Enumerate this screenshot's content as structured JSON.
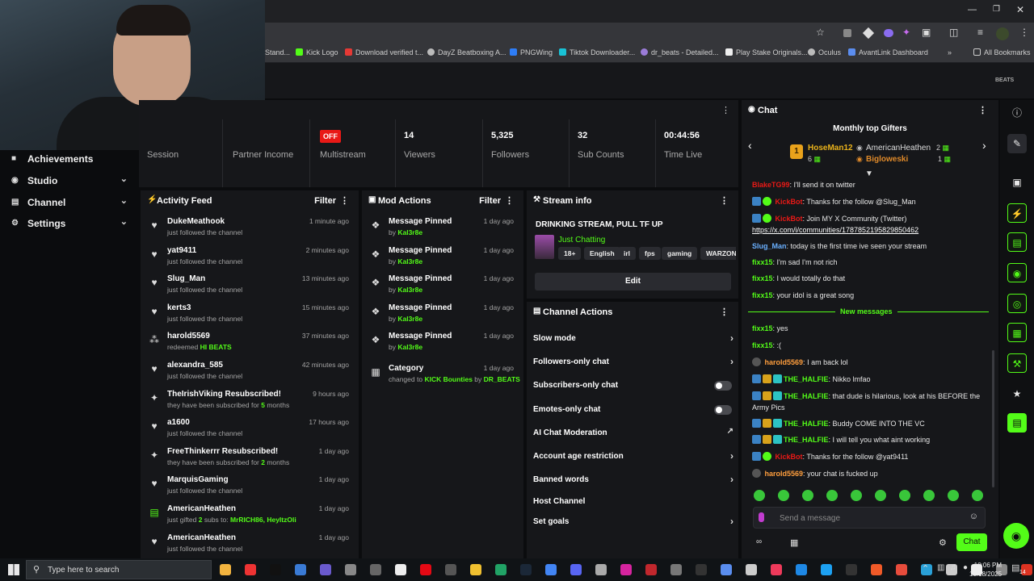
{
  "browser": {
    "bookmarks": [
      "Stand...",
      "Kick Logo",
      "Download verified t...",
      "DayZ Beatboxing A...",
      "PNGWing",
      "Tiktok Downloader...",
      "dr_beats - Detailed...",
      "Play Stake Originals...",
      "Oculus",
      "AvantLink Dashboard"
    ],
    "all_bookmarks": "All Bookmarks"
  },
  "brand_label": "BEATS",
  "nav": [
    {
      "label": "Achievements",
      "icon": "trophy-icon"
    },
    {
      "label": "Studio",
      "icon": "studio-icon"
    },
    {
      "label": "Channel",
      "icon": "channel-icon"
    },
    {
      "label": "Settings",
      "icon": "gear-icon"
    }
  ],
  "stats": {
    "session_label": "Session",
    "partner_label": "Partner Income",
    "multistream_badge": "OFF",
    "multistream_label": "Multistream",
    "viewers": "14",
    "viewers_label": "Viewers",
    "followers": "5,325",
    "followers_label": "Followers",
    "subs": "32",
    "subs_label": "Sub Counts",
    "time": "00:44:56",
    "time_label": "Time Live"
  },
  "activity": {
    "title": "Activity Feed",
    "filter": "Filter",
    "items": [
      {
        "name": "DukeMeathook",
        "sub": "just followed the channel",
        "time": "1 minute ago",
        "icon": "♥"
      },
      {
        "name": "yat9411",
        "sub": "just followed the channel",
        "time": "2 minutes ago",
        "icon": "♥"
      },
      {
        "name": "Slug_Man",
        "sub": "just followed the channel",
        "time": "13 minutes ago",
        "icon": "♥"
      },
      {
        "name": "kerts3",
        "sub": "just followed the channel",
        "time": "15 minutes ago",
        "icon": "♥"
      },
      {
        "name": "harold5569",
        "sub": "redeemed ",
        "hl": "HI BEATS",
        "time": "37 minutes ago",
        "icon": "⁂"
      },
      {
        "name": "alexandra_585",
        "sub": "just followed the channel",
        "time": "42 minutes ago",
        "icon": "♥"
      },
      {
        "name": "TheIrishViking Resubscribed!",
        "sub": "they have been subscribed for ",
        "hl": "5",
        "sub2": " months",
        "time": "9 hours ago",
        "icon": "✦"
      },
      {
        "name": "a1600",
        "sub": "just followed the channel",
        "time": "17 hours ago",
        "icon": "♥"
      },
      {
        "name": "FreeThinkerrr Resubscribed!",
        "sub": "they have been subscribed for ",
        "hl": "2",
        "sub2": " months",
        "time": "1 day ago",
        "icon": "✦"
      },
      {
        "name": "MarquisGaming",
        "sub": "just followed the channel",
        "time": "1 day ago",
        "icon": "♥"
      },
      {
        "name": "AmericanHeathen",
        "sub": "just gifted ",
        "hl": "2",
        "sub2": " subs to: ",
        "hl2": "MrRICH86, HeyItzOli",
        "time": "1 day ago",
        "icon": "▤"
      },
      {
        "name": "AmericanHeathen",
        "sub": "just followed the channel",
        "time": "1 day ago",
        "icon": "♥"
      }
    ]
  },
  "mod": {
    "title": "Mod Actions",
    "filter": "Filter",
    "items": [
      {
        "name": "Message Pinned",
        "by": "by ",
        "who": "Kal3r8e",
        "time": "1 day ago"
      },
      {
        "name": "Message Pinned",
        "by": "by ",
        "who": "Kal3r8e",
        "time": "1 day ago"
      },
      {
        "name": "Message Pinned",
        "by": "by ",
        "who": "Kal3r8e",
        "time": "1 day ago"
      },
      {
        "name": "Message Pinned",
        "by": "by ",
        "who": "Kal3r8e",
        "time": "1 day ago"
      },
      {
        "name": "Message Pinned",
        "by": "by ",
        "who": "Kal3r8e",
        "time": "1 day ago"
      }
    ],
    "category": {
      "name": "Category",
      "pre": "changed to ",
      "val": "KICK Bounties",
      "mid": " by ",
      "who": "DR_BEATS",
      "time": "1 day ago"
    }
  },
  "stream": {
    "title": "Stream info",
    "stream_title": "DRINKING STREAM, PULL TF UP",
    "category": "Just Chatting",
    "tags": [
      "18+",
      "English",
      "irl",
      "fps",
      "gaming",
      "WARZONE"
    ],
    "edit": "Edit"
  },
  "channel_actions": {
    "title": "Channel Actions",
    "items": [
      {
        "label": "Slow mode",
        "ctl": "chevron"
      },
      {
        "label": "Followers-only chat",
        "ctl": "chevron"
      },
      {
        "label": "Subscribers-only chat",
        "ctl": "toggle"
      },
      {
        "label": "Emotes-only chat",
        "ctl": "toggle"
      },
      {
        "label": "AI Chat Moderation",
        "ctl": "ext"
      },
      {
        "label": "Account age restriction",
        "ctl": "chevron"
      },
      {
        "label": "Banned words",
        "ctl": "chevron"
      },
      {
        "label": "Host Channel",
        "ctl": "none"
      },
      {
        "label": "Set goals",
        "ctl": "chevron"
      }
    ]
  },
  "chat": {
    "title": "Chat",
    "gifters_title": "Monthly top Gifters",
    "gifter1": {
      "name": "HoseMan12",
      "rank": "1",
      "count": "6"
    },
    "gifter2": {
      "name": "AmericanHeathen",
      "count": "2"
    },
    "gifter3": {
      "name": "Bigloweski",
      "count": "1"
    },
    "new_messages": "New messages",
    "placeholder": "Send a message",
    "chat_button": "Chat",
    "messages": [
      {
        "user": "BlakeTG99",
        "color": "#e91916",
        "text": "I'll send it on twitter",
        "badges": 0
      },
      {
        "user": "KickBot",
        "color": "#e91916",
        "text": "Thanks for the follow @Slug_Man",
        "badges": 2
      },
      {
        "user": "KickBot",
        "color": "#e91916",
        "text": "Join MY X Community (Twitter)",
        "link": "https://x.com/i/communities/1787852195829850462",
        "badges": 2
      },
      {
        "user": "Slug_Man",
        "color": "#6ab0ff",
        "text": "today is the first time ive seen your stream",
        "badges": 0
      },
      {
        "user": "fixx15",
        "color": "#53fc18",
        "text": "I'm sad I'm not rich",
        "badges": 0
      },
      {
        "user": "fixx15",
        "color": "#53fc18",
        "text": "I would totally do that",
        "badges": 0
      },
      {
        "user": "fixx15",
        "color": "#53fc18",
        "text": "your idol is a great song",
        "badges": 0
      },
      {
        "user": "fixx15",
        "color": "#53fc18",
        "text": "yes",
        "badges": 0
      },
      {
        "user": "fixx15",
        "color": "#53fc18",
        "text": ":(",
        "badges": 0
      },
      {
        "user": "harold5569",
        "color": "#ff9e3d",
        "text": "I am back lol",
        "badges": 1
      },
      {
        "user": "THE_HALFIE",
        "color": "#53fc18",
        "text": "Nikko lmfao",
        "badges": 3
      },
      {
        "user": "THE_HALFIE",
        "color": "#53fc18",
        "text": "that dude is hilarious, look at his BEFORE the Army Pics",
        "badges": 3
      },
      {
        "user": "THE_HALFIE",
        "color": "#53fc18",
        "text": "Buddy COME INTO THE VC",
        "badges": 3
      },
      {
        "user": "THE_HALFIE",
        "color": "#53fc18",
        "text": "I will tell you what aint working",
        "badges": 3
      },
      {
        "user": "KickBot",
        "color": "#e91916",
        "text": "Thanks for the follow @yat9411",
        "badges": 2
      },
      {
        "user": "harold5569",
        "color": "#ff9e3d",
        "text": "your chat is fucked up",
        "badges": 1
      }
    ]
  },
  "taskbar": {
    "search": "Type here to search",
    "time": "10:06 PM",
    "date": "10/18/2025",
    "notif": "14"
  },
  "colors": {
    "accent": "#53fc18",
    "offline": "#e91916",
    "panel": "#16171a"
  }
}
